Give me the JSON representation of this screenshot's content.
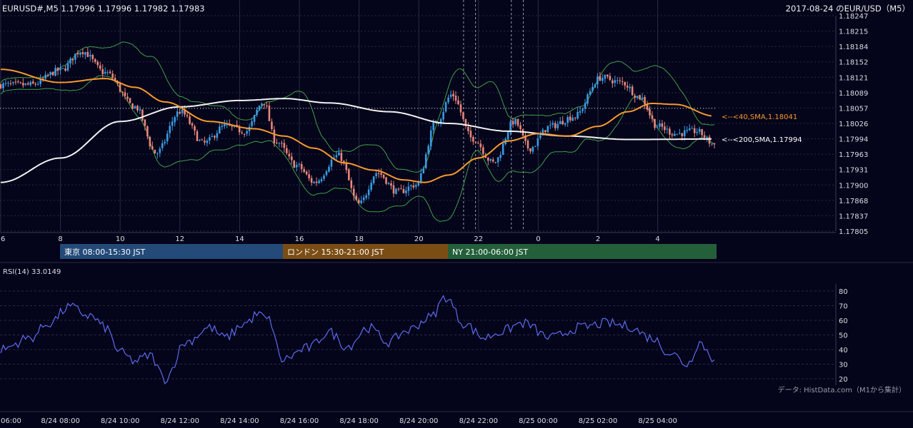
{
  "header": {
    "symbol_quote": "EURUSD#,M5 1.17996 1.17996 1.17982 1.17983",
    "date_title": "2017-08-24 のEUR/USD（M5）"
  },
  "colors": {
    "background": "#04041a",
    "bull_candle": "#3a9be0",
    "bear_candle": "#e8867a",
    "sma40": "#f59a2e",
    "sma200": "#f2f2f2",
    "bollinger": "#3f9f4a",
    "rsi": "#5b6cf0",
    "grid": "#2a2a46"
  },
  "sessions": [
    {
      "label": "東京 08:00-15:30 JST",
      "color": "#234a78"
    },
    {
      "label": "ロンドン 15:30-21:00 JST",
      "color": "#7a4d14"
    },
    {
      "label": "NY 21:00-06:00 JST",
      "color": "#23603a"
    }
  ],
  "indicators": {
    "sma40_label": "<--<40,SMA,1.18041",
    "sma200_label": "<--<200,SMA,1.17994",
    "rsi_label": "RSI(14) 33.0149"
  },
  "credit": "データ: HistData.com（M1から集計）",
  "chart_data": [
    {
      "type": "candlestick",
      "title": "EURUSD#,M5",
      "ylim": [
        1.17805,
        1.18247
      ],
      "y_ticks": [
        "1.18247",
        "1.18215",
        "1.18184",
        "1.18152",
        "1.18121",
        "1.18089",
        "1.18057",
        "1.18026",
        "1.17994",
        "1.17963",
        "1.17931",
        "1.17900",
        "1.17868",
        "1.17837",
        "1.17805"
      ],
      "x_ticks": [
        "6",
        "8",
        "10",
        "12",
        "14",
        "16",
        "18",
        "20",
        "22",
        "0",
        "2",
        "4"
      ],
      "current_price_line": 1.18057,
      "key_points": [
        {
          "hour": 6.0,
          "price": 1.18105
        },
        {
          "hour": 7.0,
          "price": 1.18105
        },
        {
          "hour": 8.0,
          "price": 1.18135
        },
        {
          "hour": 8.7,
          "price": 1.18175
        },
        {
          "hour": 9.5,
          "price": 1.1813
        },
        {
          "hour": 10.5,
          "price": 1.1806
        },
        {
          "hour": 11.2,
          "price": 1.17965
        },
        {
          "hour": 12.0,
          "price": 1.1805
        },
        {
          "hour": 12.8,
          "price": 1.17985
        },
        {
          "hour": 13.5,
          "price": 1.1802
        },
        {
          "hour": 14.2,
          "price": 1.1801
        },
        {
          "hour": 14.8,
          "price": 1.1807
        },
        {
          "hour": 15.2,
          "price": 1.1799
        },
        {
          "hour": 15.9,
          "price": 1.1794
        },
        {
          "hour": 16.5,
          "price": 1.17905
        },
        {
          "hour": 17.3,
          "price": 1.1796
        },
        {
          "hour": 18.0,
          "price": 1.1786
        },
        {
          "hour": 18.6,
          "price": 1.17925
        },
        {
          "hour": 19.3,
          "price": 1.17885
        },
        {
          "hour": 19.9,
          "price": 1.179
        },
        {
          "hour": 20.6,
          "price": 1.1803
        },
        {
          "hour": 21.1,
          "price": 1.18085
        },
        {
          "hour": 21.8,
          "price": 1.17995
        },
        {
          "hour": 22.5,
          "price": 1.17945
        },
        {
          "hour": 23.2,
          "price": 1.1803
        },
        {
          "hour": 23.7,
          "price": 1.17975
        },
        {
          "hour": 24.4,
          "price": 1.1802
        },
        {
          "hour": 25.2,
          "price": 1.1804
        },
        {
          "hour": 26.1,
          "price": 1.1812
        },
        {
          "hour": 26.8,
          "price": 1.1811
        },
        {
          "hour": 27.4,
          "price": 1.1808
        },
        {
          "hour": 28.0,
          "price": 1.1802
        },
        {
          "hour": 28.6,
          "price": 1.18005
        },
        {
          "hour": 29.3,
          "price": 1.1801
        },
        {
          "hour": 29.9,
          "price": 1.17983
        }
      ],
      "sma40_points": [
        {
          "hour": 6.0,
          "value": 1.18137
        },
        {
          "hour": 8.0,
          "value": 1.1811
        },
        {
          "hour": 9.5,
          "value": 1.18118
        },
        {
          "hour": 10.5,
          "value": 1.181
        },
        {
          "hour": 11.5,
          "value": 1.1807
        },
        {
          "hour": 13.0,
          "value": 1.1803
        },
        {
          "hour": 14.5,
          "value": 1.18015
        },
        {
          "hour": 15.5,
          "value": 1.18
        },
        {
          "hour": 16.5,
          "value": 1.17975
        },
        {
          "hour": 17.5,
          "value": 1.17945
        },
        {
          "hour": 18.5,
          "value": 1.1793
        },
        {
          "hour": 19.5,
          "value": 1.1791
        },
        {
          "hour": 20.2,
          "value": 1.17905
        },
        {
          "hour": 21.0,
          "value": 1.1792
        },
        {
          "hour": 22.0,
          "value": 1.17955
        },
        {
          "hour": 23.0,
          "value": 1.1799
        },
        {
          "hour": 24.0,
          "value": 1.18005
        },
        {
          "hour": 25.0,
          "value": 1.18
        },
        {
          "hour": 26.0,
          "value": 1.1802
        },
        {
          "hour": 27.0,
          "value": 1.1805
        },
        {
          "hour": 27.8,
          "value": 1.18067
        },
        {
          "hour": 28.6,
          "value": 1.18065
        },
        {
          "hour": 29.9,
          "value": 1.18041
        }
      ],
      "sma200_points": [
        {
          "hour": 6.0,
          "value": 1.17905
        },
        {
          "hour": 8.0,
          "value": 1.17955
        },
        {
          "hour": 10.0,
          "value": 1.1803
        },
        {
          "hour": 12.0,
          "value": 1.1806
        },
        {
          "hour": 14.0,
          "value": 1.18073
        },
        {
          "hour": 15.5,
          "value": 1.18077
        },
        {
          "hour": 17.0,
          "value": 1.18068
        },
        {
          "hour": 19.0,
          "value": 1.1805
        },
        {
          "hour": 21.0,
          "value": 1.18026
        },
        {
          "hour": 23.0,
          "value": 1.1801
        },
        {
          "hour": 25.0,
          "value": 1.18
        },
        {
          "hour": 27.0,
          "value": 1.17993
        },
        {
          "hour": 29.9,
          "value": 1.17994
        }
      ]
    },
    {
      "type": "line",
      "title": "RSI(14) 33.0149",
      "ylim": [
        15,
        85
      ],
      "y_ticks": [
        "80",
        "70",
        "60",
        "50",
        "40",
        "30",
        "20"
      ],
      "x_ticks": [
        "06:00",
        "8/24 08:00",
        "8/24 10:00",
        "8/24 12:00",
        "8/24 14:00",
        "8/24 16:00",
        "8/24 18:00",
        "8/24 20:00",
        "8/24 22:00",
        "8/25 00:00",
        "8/25 02:00",
        "8/25 04:00"
      ],
      "key_points": [
        {
          "hour": 6.0,
          "value": 40
        },
        {
          "hour": 7.0,
          "value": 48
        },
        {
          "hour": 7.6,
          "value": 58
        },
        {
          "hour": 8.3,
          "value": 69
        },
        {
          "hour": 9.0,
          "value": 63
        },
        {
          "hour": 9.5,
          "value": 55
        },
        {
          "hour": 10.0,
          "value": 38
        },
        {
          "hour": 10.5,
          "value": 32
        },
        {
          "hour": 11.0,
          "value": 36
        },
        {
          "hour": 11.5,
          "value": 20
        },
        {
          "hour": 12.2,
          "value": 45
        },
        {
          "hour": 13.0,
          "value": 55
        },
        {
          "hour": 13.5,
          "value": 48
        },
        {
          "hour": 14.2,
          "value": 58
        },
        {
          "hour": 14.6,
          "value": 64
        },
        {
          "hour": 15.0,
          "value": 60
        },
        {
          "hour": 15.4,
          "value": 33
        },
        {
          "hour": 16.3,
          "value": 41
        },
        {
          "hour": 17.0,
          "value": 52
        },
        {
          "hour": 17.6,
          "value": 42
        },
        {
          "hour": 18.3,
          "value": 55
        },
        {
          "hour": 19.0,
          "value": 45
        },
        {
          "hour": 19.6,
          "value": 53
        },
        {
          "hour": 20.4,
          "value": 62
        },
        {
          "hour": 20.9,
          "value": 76
        },
        {
          "hour": 21.5,
          "value": 58
        },
        {
          "hour": 22.2,
          "value": 48
        },
        {
          "hour": 22.7,
          "value": 52
        },
        {
          "hour": 23.5,
          "value": 58
        },
        {
          "hour": 24.4,
          "value": 48
        },
        {
          "hour": 25.4,
          "value": 55
        },
        {
          "hour": 26.3,
          "value": 58
        },
        {
          "hour": 27.0,
          "value": 56
        },
        {
          "hour": 27.8,
          "value": 48
        },
        {
          "hour": 28.4,
          "value": 38
        },
        {
          "hour": 29.0,
          "value": 30
        },
        {
          "hour": 29.4,
          "value": 45
        },
        {
          "hour": 29.9,
          "value": 33
        }
      ]
    }
  ]
}
